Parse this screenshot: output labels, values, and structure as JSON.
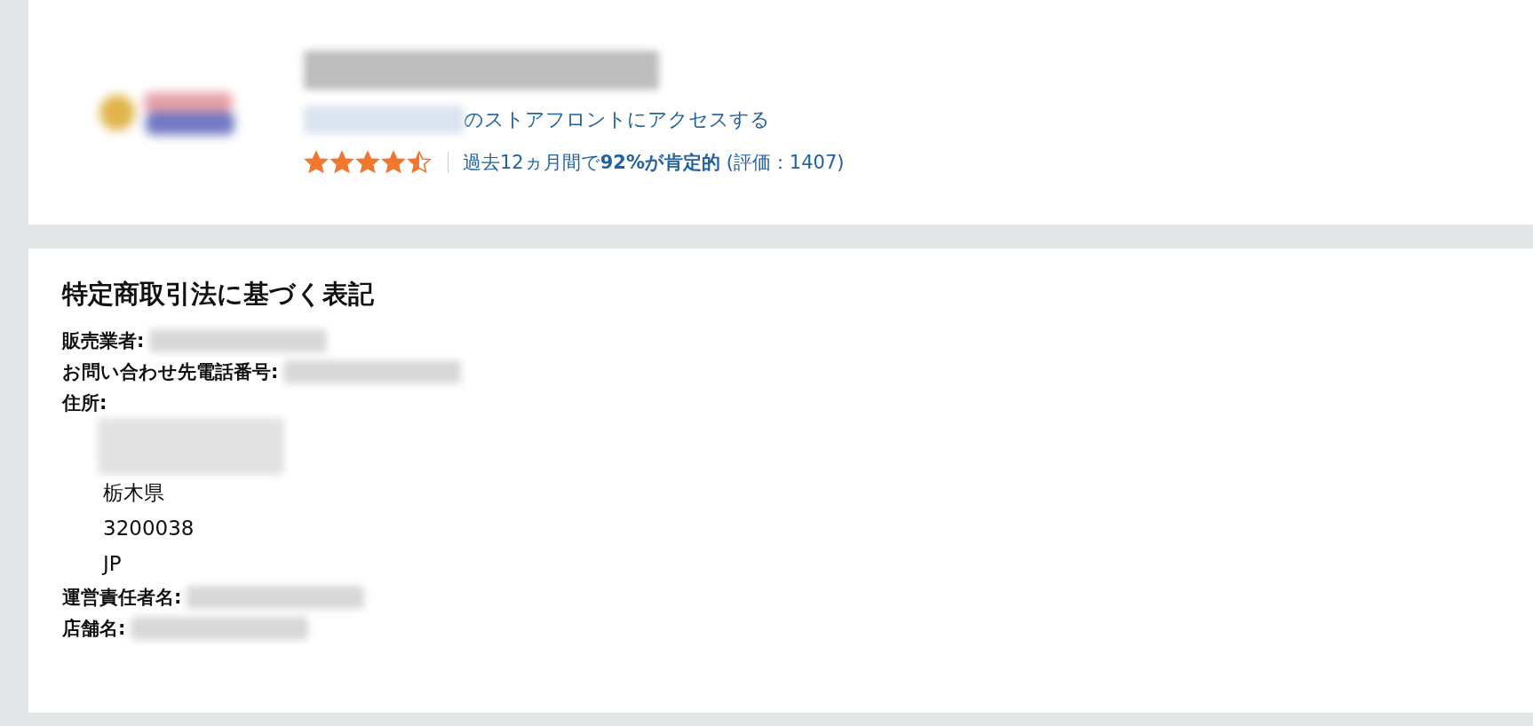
{
  "store_header": {
    "storefront_link": "のストアフロントにアクセスする",
    "stars": 4.5,
    "rating_summary": "過去12ヵ月間で**92%が肯定的** (評価：1407)"
  },
  "legal_notice": {
    "title": "特定商取引法に基づく表記",
    "fields": [
      {
        "kind": "redacted",
        "label": "販売業者:"
      },
      {
        "kind": "redacted",
        "label": "お問い合わせ先電話番号:"
      },
      {
        "kind": "address",
        "label": "住所:",
        "lines": [
          "栃木県",
          "3200038",
          "JP"
        ]
      },
      {
        "kind": "redacted",
        "label": "運営責任者名:"
      },
      {
        "kind": "redacted",
        "label": "店舗名:"
      }
    ]
  }
}
